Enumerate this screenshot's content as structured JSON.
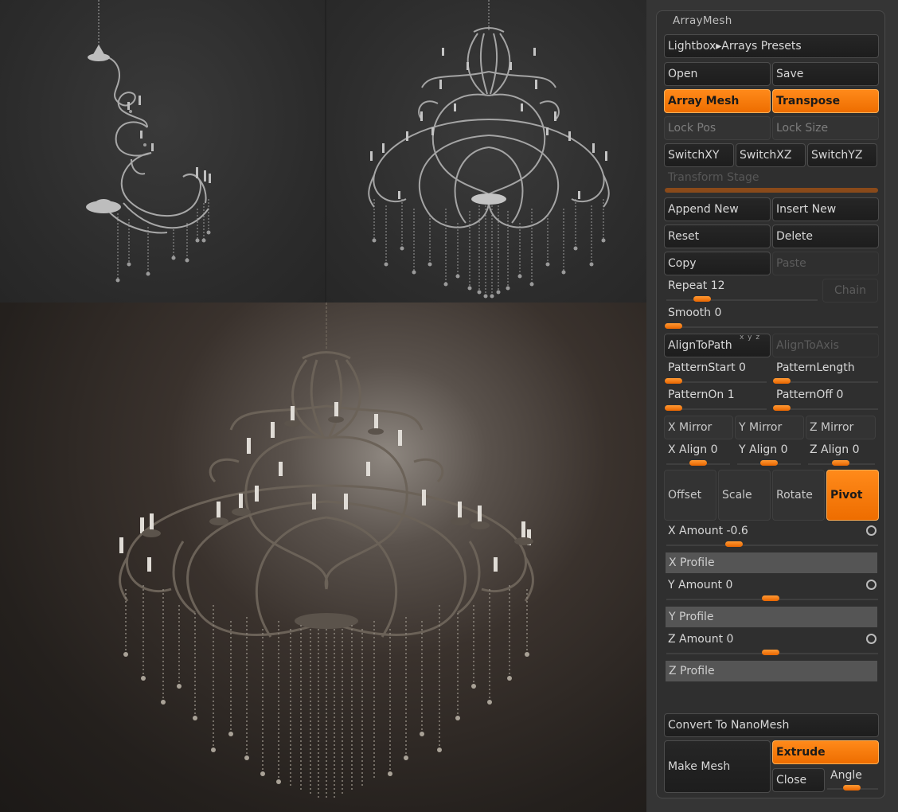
{
  "panel": {
    "title": "ArrayMesh",
    "lightbox": "Lightbox▸Arrays Presets",
    "open": "Open",
    "save": "Save",
    "array_mesh": "Array Mesh",
    "transpose": "Transpose",
    "lock_pos": "Lock Pos",
    "lock_size": "Lock Size",
    "switch_xy": "SwitchXY",
    "switch_xz": "SwitchXZ",
    "switch_yz": "SwitchYZ",
    "transform_stage": "Transform Stage",
    "append_new": "Append New",
    "insert_new": "Insert New",
    "reset": "Reset",
    "delete": "Delete",
    "copy": "Copy",
    "paste": "Paste",
    "repeat": {
      "label": "Repeat 12",
      "value": 12
    },
    "chain": "Chain",
    "smooth": {
      "label": "Smooth 0",
      "value": 0
    },
    "align_to_path": "AlignToPath",
    "align_axes": "x y z",
    "align_to_axis": "AlignToAxis",
    "pattern_start": {
      "label": "PatternStart 0",
      "value": 0
    },
    "pattern_length": {
      "label": "PatternLength",
      "value": 0
    },
    "pattern_on": {
      "label": "PatternOn 1",
      "value": 1
    },
    "pattern_off": {
      "label": "PatternOff 0",
      "value": 0
    },
    "x_mirror": "X Mirror",
    "y_mirror": "Y Mirror",
    "z_mirror": "Z Mirror",
    "x_align": {
      "label": "X Align 0",
      "value": 0
    },
    "y_align": {
      "label": "Y Align 0",
      "value": 0
    },
    "z_align": {
      "label": "Z Align 0",
      "value": 0
    },
    "offset": "Offset",
    "scale": "Scale",
    "rotate": "Rotate",
    "pivot": "Pivot",
    "x_amount": {
      "label": "X Amount -0.6",
      "value": -0.6
    },
    "x_profile": "X Profile",
    "y_amount": {
      "label": "Y Amount 0",
      "value": 0
    },
    "y_profile": "Y Profile",
    "z_amount": {
      "label": "Z Amount 0",
      "value": 0
    },
    "z_profile": "Z Profile",
    "convert": "Convert To NanoMesh",
    "make_mesh": "Make Mesh",
    "extrude": "Extrude",
    "close": "Close",
    "angle": "Angle"
  },
  "colors": {
    "accent": "#f07800",
    "panel_bg": "#2f2f2f",
    "viewport_bg": "#2e2e2e"
  },
  "viewports": [
    "chandelier-arm-preview",
    "chandelier-wireframe-preview",
    "chandelier-render"
  ]
}
